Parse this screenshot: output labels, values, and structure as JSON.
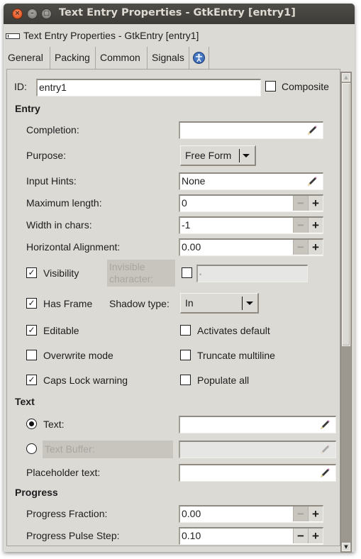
{
  "window": {
    "title": "Text Entry Properties - GtkEntry [entry1]",
    "controls": {
      "close": "×",
      "minimize": "–",
      "maximize": "□"
    }
  },
  "subheader": {
    "title": "Text Entry Properties - GtkEntry [entry1]",
    "icon": "entry-widget-icon"
  },
  "tabs": [
    {
      "label": "General",
      "active": true
    },
    {
      "label": "Packing",
      "active": false
    },
    {
      "label": "Common",
      "active": false
    },
    {
      "label": "Signals",
      "active": false
    },
    {
      "label": "",
      "icon": "accessibility-icon",
      "active": false
    }
  ],
  "id_row": {
    "label": "ID:",
    "value": "entry1",
    "composite_label": "Composite",
    "composite_checked": false
  },
  "sections": {
    "entry": "Entry",
    "text": "Text",
    "progress": "Progress"
  },
  "entry": {
    "completion": {
      "label": "Completion:",
      "value": ""
    },
    "purpose": {
      "label": "Purpose:",
      "value": "Free Form"
    },
    "input_hints": {
      "label": "Input Hints:",
      "value": "None"
    },
    "max_length": {
      "label": "Maximum length:",
      "value": "0",
      "minus": "−",
      "plus": "+"
    },
    "width_chars": {
      "label": "Width in chars:",
      "value": "-1",
      "minus": "−",
      "plus": "+"
    },
    "h_align": {
      "label": "Horizontal Alignment:",
      "value": "0.00",
      "minus": "−",
      "plus": "+"
    },
    "visibility": {
      "label": "Visibility",
      "checked": true,
      "check_glyph": "✓"
    },
    "invisible_char": {
      "label_line1": "Invisible",
      "label_line2": "character:",
      "checked": false,
      "value": "•"
    },
    "has_frame": {
      "label": "Has Frame",
      "checked": true,
      "check_glyph": "✓"
    },
    "shadow_type": {
      "label": "Shadow type:",
      "value": "In"
    },
    "editable": {
      "label": "Editable",
      "checked": true,
      "check_glyph": "✓"
    },
    "activates_default": {
      "label": "Activates default",
      "checked": false
    },
    "overwrite_mode": {
      "label": "Overwrite mode",
      "checked": false
    },
    "truncate_multiline": {
      "label": "Truncate multiline",
      "checked": false
    },
    "caps_lock_warning": {
      "label": "Caps Lock warning",
      "checked": true,
      "check_glyph": "✓"
    },
    "populate_all": {
      "label": "Populate all",
      "checked": false
    }
  },
  "text": {
    "text": {
      "label": "Text:",
      "selected": true,
      "value": ""
    },
    "text_buffer": {
      "label": "Text Buffer:",
      "selected": false,
      "value": ""
    },
    "placeholder": {
      "label": "Placeholder text:",
      "value": ""
    }
  },
  "progress": {
    "fraction": {
      "label": "Progress Fraction:",
      "value": "0.00",
      "minus": "−",
      "plus": "+"
    },
    "pulse_step": {
      "label": "Progress Pulse Step:",
      "value": "0.10",
      "minus": "−",
      "plus": "+"
    }
  },
  "scrollbar": {
    "up": "▲",
    "down": "▼",
    "position_fraction": 0.0,
    "visible_fraction": 0.55
  }
}
